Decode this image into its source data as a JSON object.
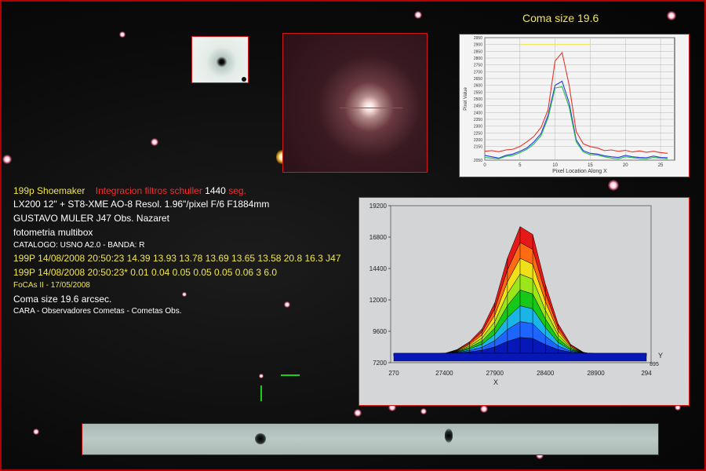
{
  "coma_header": "Coma size 19.6",
  "info": {
    "object": "199p Shoemaker",
    "filters": "Integracion filtros schuller",
    "exposure": "1440",
    "exposure_unit": "seg.",
    "equipment": "LX200 12\" +  ST8-XME AO-8  Resol. 1.96\"/pixel  F/6  F1884mm",
    "observer": "GUSTAVO MULER  J47 Obs. Nazaret",
    "method": "fotometria multibox",
    "catalog": "CATALOGO: USNO A2.0 - BANDA: R",
    "line1": "199P 14/08/2008 20:50:23 14.39 13.93 13.78 13.69 13.65 13.58 20.8 16.3 J47",
    "line2": "199P 14/08/2008 20:50:23* 0.01 0.04 0.05 0.05 0.05 0.06 3 6.0",
    "software": "FoCAs II - 17/05/2008",
    "coma": "Coma size 19.6  arcsec.",
    "credits": "CARA -  Observadores Cometas  -  Cometas Obs."
  },
  "colors": {
    "yellow": "#f2e64a",
    "red": "#ff2a2a",
    "white": "#ffffff",
    "frame": "#b00000"
  },
  "chart_data": [
    {
      "type": "line",
      "xlabel": "Pixel Location Along X",
      "ylabel": "Pixel Value",
      "xlim": [
        0,
        27
      ],
      "ylim": [
        2050,
        2950
      ],
      "xticks": [
        0,
        5,
        10,
        15,
        20,
        25
      ],
      "yticks": [
        2050,
        2150,
        2200,
        2250,
        2300,
        2350,
        2400,
        2450,
        2500,
        2550,
        2600,
        2650,
        2700,
        2750,
        2800,
        2850,
        2900,
        2950
      ],
      "grid": true,
      "x": [
        0,
        1,
        2,
        3,
        4,
        5,
        6,
        7,
        8,
        9,
        10,
        11,
        12,
        13,
        14,
        15,
        16,
        17,
        18,
        19,
        20,
        21,
        22,
        23,
        24,
        25,
        26
      ],
      "series": [
        {
          "color": "#e8322a",
          "values": [
            2115,
            2120,
            2112,
            2125,
            2130,
            2150,
            2185,
            2225,
            2290,
            2420,
            2780,
            2840,
            2600,
            2260,
            2170,
            2150,
            2140,
            2120,
            2125,
            2115,
            2122,
            2110,
            2118,
            2108,
            2115,
            2105,
            2100
          ]
        },
        {
          "color": "#2a3ee0",
          "values": [
            2085,
            2075,
            2065,
            2085,
            2095,
            2115,
            2140,
            2185,
            2245,
            2380,
            2600,
            2630,
            2470,
            2200,
            2120,
            2100,
            2095,
            2082,
            2075,
            2070,
            2085,
            2075,
            2070,
            2068,
            2080,
            2070,
            2068
          ]
        },
        {
          "color": "#2ab84a",
          "values": [
            2070,
            2065,
            2060,
            2078,
            2085,
            2105,
            2130,
            2170,
            2230,
            2360,
            2580,
            2590,
            2440,
            2185,
            2110,
            2090,
            2088,
            2075,
            2065,
            2060,
            2075,
            2068,
            2062,
            2060,
            2070,
            2065,
            2060
          ]
        }
      ],
      "annotation": {
        "type": "horizontal-line",
        "color": "#f2e64a",
        "y": 2900,
        "x_range": [
          5,
          15
        ]
      }
    },
    {
      "type": "area",
      "xlabel": "X",
      "ylabel": "Y",
      "ylim": [
        7200,
        19200
      ],
      "yticks": [
        7200,
        9600,
        12000,
        14400,
        16800,
        19200
      ],
      "xtick_labels": [
        "270",
        "27400",
        "27900",
        "28400",
        "28900",
        "294"
      ],
      "side_label": "895",
      "grid": false,
      "x": [
        0,
        1,
        2,
        3,
        4,
        5,
        6,
        7,
        8,
        9,
        10,
        11,
        12,
        13,
        14,
        15,
        16,
        17,
        18,
        19,
        20
      ],
      "values": [
        7700,
        7650,
        7800,
        7700,
        7900,
        8200,
        8800,
        9800,
        11800,
        15200,
        17600,
        17000,
        13200,
        10200,
        8600,
        8000,
        7800,
        7750,
        7700,
        7650,
        7700
      ],
      "color_bands": [
        "#0818b8",
        "#1e64ff",
        "#1ab4e6",
        "#18c818",
        "#9ae61a",
        "#f0e01a",
        "#ff6a12",
        "#e61818"
      ]
    }
  ]
}
